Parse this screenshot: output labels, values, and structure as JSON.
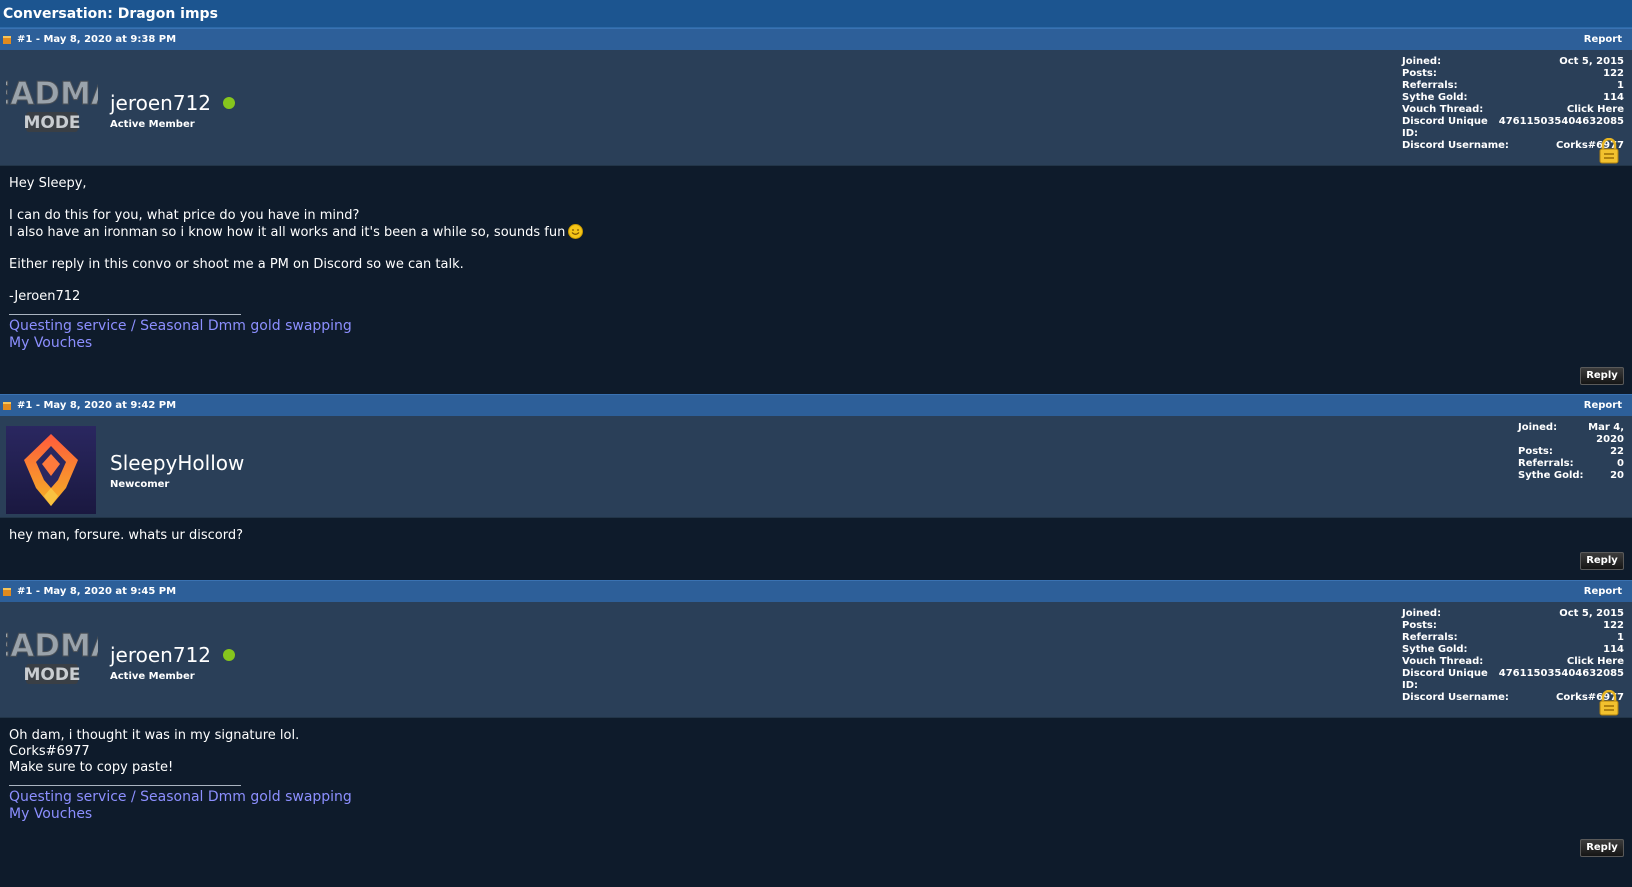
{
  "page": {
    "title": "Conversation: Dragon imps"
  },
  "posts": [
    {
      "header": "#1 - May 8, 2020 at 9:38 PM",
      "report_label": "Report",
      "username": "jeroen712",
      "user_title": "Active Member",
      "online": true,
      "stats": [
        {
          "label": "Joined:",
          "value": "Oct 5, 2015"
        },
        {
          "label": "Posts:",
          "value": "122"
        },
        {
          "label": "Referrals:",
          "value": "1"
        },
        {
          "label": "Sythe Gold:",
          "value": "114"
        },
        {
          "label": "Vouch Thread:",
          "value": "Click Here"
        },
        {
          "label": "Discord Unique ID:",
          "value": "476115035404632085"
        },
        {
          "label": "Discord Username:",
          "value": "Corks#6977"
        }
      ],
      "body": [
        "Hey Sleepy,",
        "I can do this for you, what price do you have in mind?",
        "I also have an ironman so i know how it all works and it's been a while so, sounds fun",
        "Either reply in this convo or shoot me a PM on Discord so we can talk.",
        "-Jeroen712"
      ],
      "signature_links": [
        "Questing service / Seasonal Dmm gold swapping",
        "My Vouches"
      ],
      "reply_label": "Reply"
    },
    {
      "header": "#1 - May 8, 2020 at 9:42 PM",
      "report_label": "Report",
      "username": "SleepyHollow",
      "user_title": "Newcomer",
      "online": false,
      "stats": [
        {
          "label": "Joined:",
          "value": "Mar 4, 2020"
        },
        {
          "label": "Posts:",
          "value": "22"
        },
        {
          "label": "Referrals:",
          "value": "0"
        },
        {
          "label": "Sythe Gold:",
          "value": "20"
        }
      ],
      "body": [
        "hey man, forsure. whats ur discord?"
      ],
      "reply_label": "Reply"
    },
    {
      "header": "#1 - May 8, 2020 at 9:45 PM",
      "report_label": "Report",
      "username": "jeroen712",
      "user_title": "Active Member",
      "online": true,
      "stats": [
        {
          "label": "Joined:",
          "value": "Oct 5, 2015"
        },
        {
          "label": "Posts:",
          "value": "122"
        },
        {
          "label": "Referrals:",
          "value": "1"
        },
        {
          "label": "Sythe Gold:",
          "value": "114"
        },
        {
          "label": "Vouch Thread:",
          "value": "Click Here"
        },
        {
          "label": "Discord Unique ID:",
          "value": "476115035404632085"
        },
        {
          "label": "Discord Username:",
          "value": "Corks#6977"
        }
      ],
      "body": [
        "Oh dam, i thought it was in my signature lol.",
        "Corks#6977",
        "Make sure to copy paste!"
      ],
      "signature_links": [
        "Questing service / Seasonal Dmm gold swapping",
        "My Vouches"
      ],
      "reply_label": "Reply"
    }
  ],
  "icons": {
    "post_marker": "post-marker-icon",
    "lock": "lock-icon",
    "smile": "smile-emoji-icon",
    "online": "online-status-icon"
  },
  "colors": {
    "title_bar": "#1c5590",
    "post_header": "#2d5f99",
    "user_bar": "#2a3f58",
    "body_bg": "#0e1b2b",
    "link": "#8c8fff",
    "online": "#86c51d"
  },
  "avatars": {
    "jeroen712_logo_text": [
      "EADMA",
      "MODE"
    ]
  }
}
